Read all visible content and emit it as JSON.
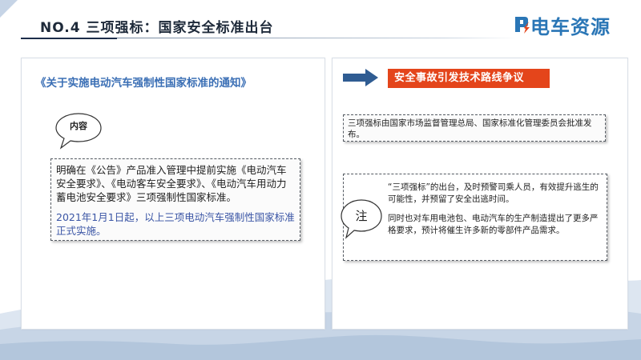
{
  "header": {
    "title": "NO.4 三项强标：国家安全标准出台",
    "logo": "电车资源"
  },
  "left_panel": {
    "doc_title": "《关于实施电动汽车强制性国家标准的通知》",
    "bubble_label": "内容",
    "paragraph1": "明确在《公告》产品准入管理中提前实施《电动汽车安全要求》、《电动客车安全要求》、《电动汽车用动力蓄电池安全要求》三项强制性国家标准。",
    "paragraph2": "2021年1月1日起，以上三项电动汽车强制性国家标准正式实施。"
  },
  "right_panel": {
    "tag": "安全事故引发技术路线争议",
    "notice": "三项强标由国家市场监督管理总局、国家标准化管理委员会批准发布。",
    "bubble_label": "注",
    "note_p1": "“三项强标”的出台，及时预警司乘人员，有效提升逃生的可能性，并预留了安全出逃时间。",
    "note_p2": "同时也对车用电池包、电动汽车的生产制造提出了更多严格要求，预计将催生许多新的零部件产品需求。"
  },
  "colors": {
    "accent_red": "#e4451b",
    "accent_blue": "#3b6fb5",
    "arrow_blue": "#2f5c92",
    "logo_blue": "#2a76b6"
  },
  "icons": {
    "arrow": "arrow-right-icon",
    "bubble": "speech-bubble-icon",
    "logo": "logo-mark-icon"
  }
}
